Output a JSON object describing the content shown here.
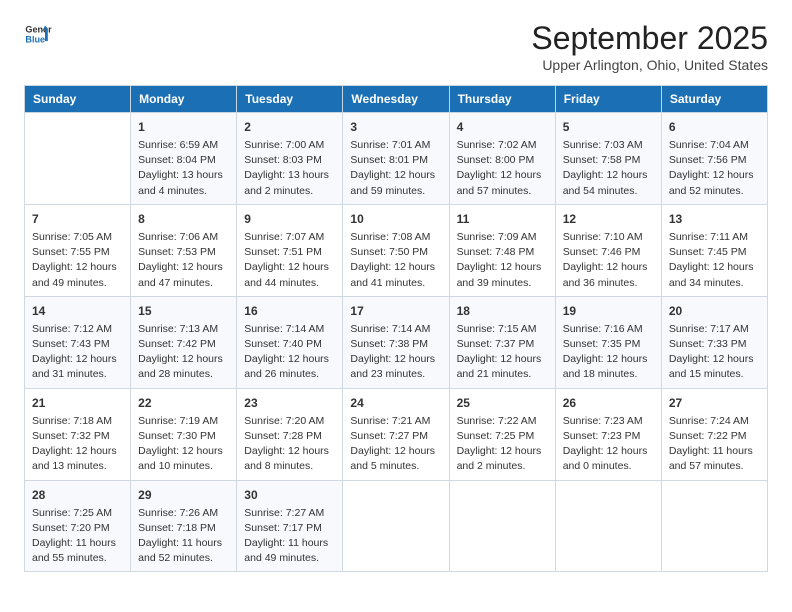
{
  "logo": {
    "line1": "General",
    "line2": "Blue"
  },
  "title": "September 2025",
  "subtitle": "Upper Arlington, Ohio, United States",
  "days_of_week": [
    "Sunday",
    "Monday",
    "Tuesday",
    "Wednesday",
    "Thursday",
    "Friday",
    "Saturday"
  ],
  "weeks": [
    [
      {
        "day": "",
        "info": ""
      },
      {
        "day": "1",
        "info": "Sunrise: 6:59 AM\nSunset: 8:04 PM\nDaylight: 13 hours\nand 4 minutes."
      },
      {
        "day": "2",
        "info": "Sunrise: 7:00 AM\nSunset: 8:03 PM\nDaylight: 13 hours\nand 2 minutes."
      },
      {
        "day": "3",
        "info": "Sunrise: 7:01 AM\nSunset: 8:01 PM\nDaylight: 12 hours\nand 59 minutes."
      },
      {
        "day": "4",
        "info": "Sunrise: 7:02 AM\nSunset: 8:00 PM\nDaylight: 12 hours\nand 57 minutes."
      },
      {
        "day": "5",
        "info": "Sunrise: 7:03 AM\nSunset: 7:58 PM\nDaylight: 12 hours\nand 54 minutes."
      },
      {
        "day": "6",
        "info": "Sunrise: 7:04 AM\nSunset: 7:56 PM\nDaylight: 12 hours\nand 52 minutes."
      }
    ],
    [
      {
        "day": "7",
        "info": "Sunrise: 7:05 AM\nSunset: 7:55 PM\nDaylight: 12 hours\nand 49 minutes."
      },
      {
        "day": "8",
        "info": "Sunrise: 7:06 AM\nSunset: 7:53 PM\nDaylight: 12 hours\nand 47 minutes."
      },
      {
        "day": "9",
        "info": "Sunrise: 7:07 AM\nSunset: 7:51 PM\nDaylight: 12 hours\nand 44 minutes."
      },
      {
        "day": "10",
        "info": "Sunrise: 7:08 AM\nSunset: 7:50 PM\nDaylight: 12 hours\nand 41 minutes."
      },
      {
        "day": "11",
        "info": "Sunrise: 7:09 AM\nSunset: 7:48 PM\nDaylight: 12 hours\nand 39 minutes."
      },
      {
        "day": "12",
        "info": "Sunrise: 7:10 AM\nSunset: 7:46 PM\nDaylight: 12 hours\nand 36 minutes."
      },
      {
        "day": "13",
        "info": "Sunrise: 7:11 AM\nSunset: 7:45 PM\nDaylight: 12 hours\nand 34 minutes."
      }
    ],
    [
      {
        "day": "14",
        "info": "Sunrise: 7:12 AM\nSunset: 7:43 PM\nDaylight: 12 hours\nand 31 minutes."
      },
      {
        "day": "15",
        "info": "Sunrise: 7:13 AM\nSunset: 7:42 PM\nDaylight: 12 hours\nand 28 minutes."
      },
      {
        "day": "16",
        "info": "Sunrise: 7:14 AM\nSunset: 7:40 PM\nDaylight: 12 hours\nand 26 minutes."
      },
      {
        "day": "17",
        "info": "Sunrise: 7:14 AM\nSunset: 7:38 PM\nDaylight: 12 hours\nand 23 minutes."
      },
      {
        "day": "18",
        "info": "Sunrise: 7:15 AM\nSunset: 7:37 PM\nDaylight: 12 hours\nand 21 minutes."
      },
      {
        "day": "19",
        "info": "Sunrise: 7:16 AM\nSunset: 7:35 PM\nDaylight: 12 hours\nand 18 minutes."
      },
      {
        "day": "20",
        "info": "Sunrise: 7:17 AM\nSunset: 7:33 PM\nDaylight: 12 hours\nand 15 minutes."
      }
    ],
    [
      {
        "day": "21",
        "info": "Sunrise: 7:18 AM\nSunset: 7:32 PM\nDaylight: 12 hours\nand 13 minutes."
      },
      {
        "day": "22",
        "info": "Sunrise: 7:19 AM\nSunset: 7:30 PM\nDaylight: 12 hours\nand 10 minutes."
      },
      {
        "day": "23",
        "info": "Sunrise: 7:20 AM\nSunset: 7:28 PM\nDaylight: 12 hours\nand 8 minutes."
      },
      {
        "day": "24",
        "info": "Sunrise: 7:21 AM\nSunset: 7:27 PM\nDaylight: 12 hours\nand 5 minutes."
      },
      {
        "day": "25",
        "info": "Sunrise: 7:22 AM\nSunset: 7:25 PM\nDaylight: 12 hours\nand 2 minutes."
      },
      {
        "day": "26",
        "info": "Sunrise: 7:23 AM\nSunset: 7:23 PM\nDaylight: 12 hours\nand 0 minutes."
      },
      {
        "day": "27",
        "info": "Sunrise: 7:24 AM\nSunset: 7:22 PM\nDaylight: 11 hours\nand 57 minutes."
      }
    ],
    [
      {
        "day": "28",
        "info": "Sunrise: 7:25 AM\nSunset: 7:20 PM\nDaylight: 11 hours\nand 55 minutes."
      },
      {
        "day": "29",
        "info": "Sunrise: 7:26 AM\nSunset: 7:18 PM\nDaylight: 11 hours\nand 52 minutes."
      },
      {
        "day": "30",
        "info": "Sunrise: 7:27 AM\nSunset: 7:17 PM\nDaylight: 11 hours\nand 49 minutes."
      },
      {
        "day": "",
        "info": ""
      },
      {
        "day": "",
        "info": ""
      },
      {
        "day": "",
        "info": ""
      },
      {
        "day": "",
        "info": ""
      }
    ]
  ]
}
